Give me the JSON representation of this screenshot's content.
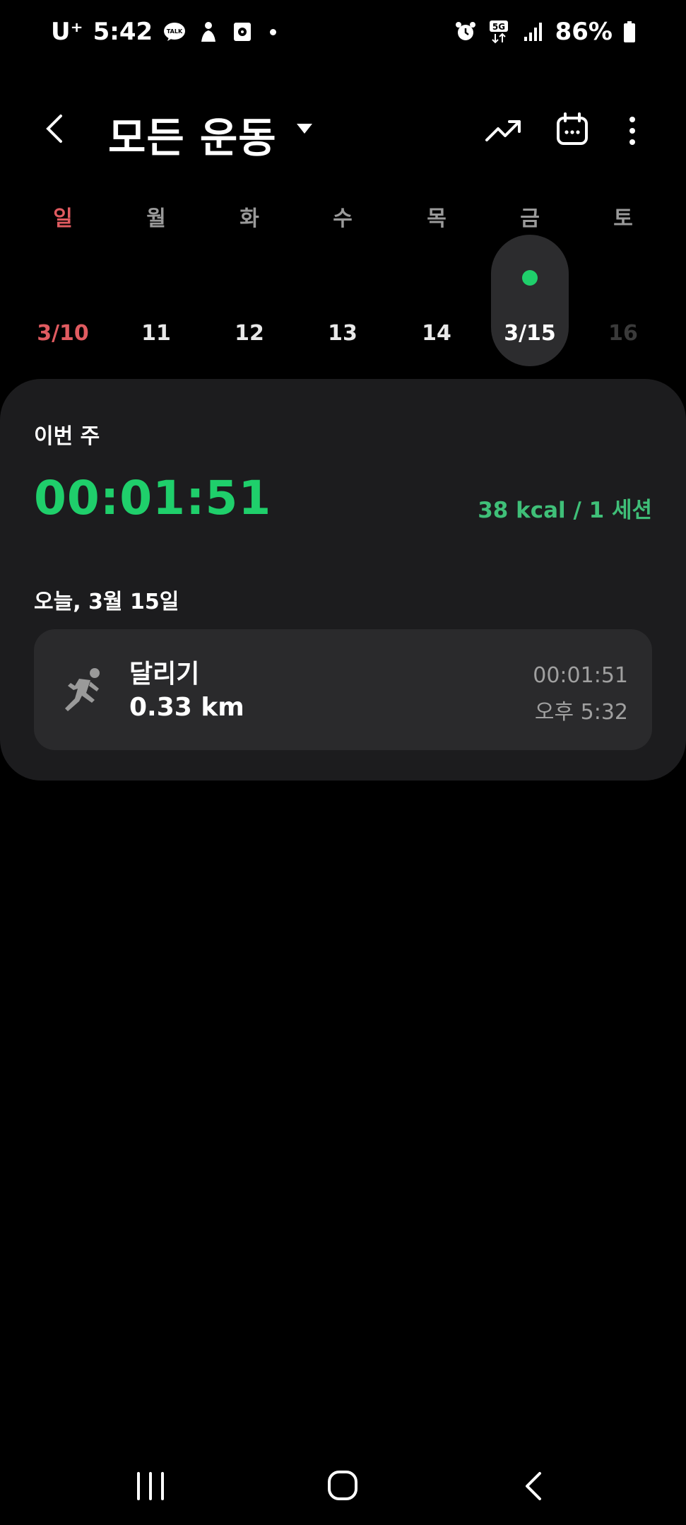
{
  "status_bar": {
    "carrier": "U⁺",
    "time": "5:42",
    "network": "5G",
    "battery": "86%",
    "icons": [
      "talk-icon",
      "notification-figure-icon",
      "screenshot-icon",
      "dot-icon",
      "alarm-icon",
      "5g-icon",
      "signal-icon",
      "battery-icon"
    ]
  },
  "app_bar": {
    "title": "모든 운동",
    "icons": [
      "back-icon",
      "dropdown-icon",
      "trend-icon",
      "calendar-icon",
      "more-icon"
    ]
  },
  "week": {
    "days": [
      {
        "name": "일",
        "date": "3/10"
      },
      {
        "name": "월",
        "date": "11"
      },
      {
        "name": "화",
        "date": "12"
      },
      {
        "name": "수",
        "date": "13"
      },
      {
        "name": "목",
        "date": "14"
      },
      {
        "name": "금",
        "date": "3/15"
      },
      {
        "name": "토",
        "date": "16"
      }
    ],
    "selected_index": 5
  },
  "summary": {
    "label": "이번 주",
    "total_time": "00:01:51",
    "details": "38 kcal / 1 세션"
  },
  "today": {
    "label": "오늘, 3월 15일",
    "workout": {
      "name": "달리기",
      "distance": "0.33 km",
      "duration": "00:01:51",
      "time": "오후 5:32",
      "icon": "running-icon"
    }
  },
  "colors": {
    "accent_green": "#1fcf6b",
    "sunday_red": "#e05b60",
    "card_bg": "#1c1c1e"
  }
}
